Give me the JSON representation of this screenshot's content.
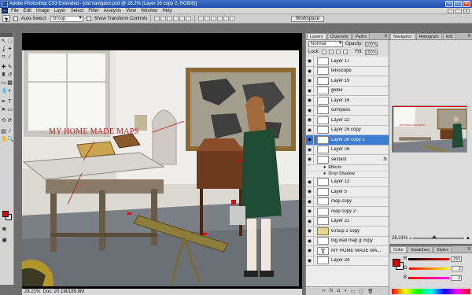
{
  "window": {
    "title": "Adobe Photoshop CS3 Extended - [old navigator.psd @ 28.2% (Layer 26 copy 2, RGB/8)]",
    "app_icon": "Ps"
  },
  "menu": [
    "File",
    "Edit",
    "Image",
    "Layer",
    "Select",
    "Filter",
    "Analysis",
    "View",
    "Window",
    "Help"
  ],
  "options": {
    "auto_select_label": "Auto-Select:",
    "auto_select_value": "Group",
    "transform_controls_label": "Show Transform Controls",
    "workspace_label": "Workspace"
  },
  "document": {
    "canvas_annotation": "MY HOME MADE MAPS",
    "status_zoom": "28.21%",
    "status_doc": "Doc: 20.1M/189.8M"
  },
  "layers_panel": {
    "tabs": [
      "Layers",
      "Channels",
      "Paths"
    ],
    "active_tab": "Layers",
    "blend_mode": "Normal",
    "opacity_label": "Opacity:",
    "opacity_value": "100%",
    "lock_label": "Lock:",
    "fill_label": "Fill:",
    "fill_value": "100%",
    "layers": [
      {
        "name": "Layer 17",
        "visible": true
      },
      {
        "name": "telescope",
        "visible": true
      },
      {
        "name": "Layer 19",
        "visible": true
      },
      {
        "name": "globe",
        "visible": true
      },
      {
        "name": "Layer 16",
        "visible": true
      },
      {
        "name": "compass",
        "visible": true
      },
      {
        "name": "Layer 22",
        "visible": true
      },
      {
        "name": "Layer 26 copy",
        "visible": true
      },
      {
        "name": "Layer 26 copy 2",
        "visible": true,
        "selected": true
      },
      {
        "name": "Layer 26",
        "visible": true
      },
      {
        "name": "sextant",
        "visible": true,
        "fx": "fx"
      },
      {
        "name": "Effects",
        "sub": true
      },
      {
        "name": "Drop Shadow",
        "sub": true
      },
      {
        "name": "Layer 12",
        "visible": true
      },
      {
        "name": "Layer 5",
        "visible": true
      },
      {
        "name": "map copy",
        "visible": true
      },
      {
        "name": "map copy 2",
        "visible": true
      },
      {
        "name": "Layer 21",
        "visible": true
      },
      {
        "name": "Group 2 copy",
        "visible": true,
        "group": true
      },
      {
        "name": "big wall map g copy",
        "visible": true
      },
      {
        "name": "MY HOME MADE MA...",
        "visible": true,
        "text": true
      },
      {
        "name": "Layer 24",
        "visible": true
      }
    ]
  },
  "navigator_panel": {
    "tabs": [
      "Navigator",
      "Histogram",
      "Info"
    ],
    "active_tab": "Navigator",
    "zoom": "28.21%",
    "preview_annotation": "MY HOME MADE MAPS"
  },
  "color_panel": {
    "tabs": [
      "Color",
      "Swatches",
      "Styles"
    ],
    "active_tab": "Color",
    "foreground": "#d40000",
    "background": "#ffffff",
    "channels": [
      {
        "label": "R",
        "value": "255"
      },
      {
        "label": "G",
        "value": "3"
      },
      {
        "label": "B",
        "value": "3"
      }
    ]
  }
}
